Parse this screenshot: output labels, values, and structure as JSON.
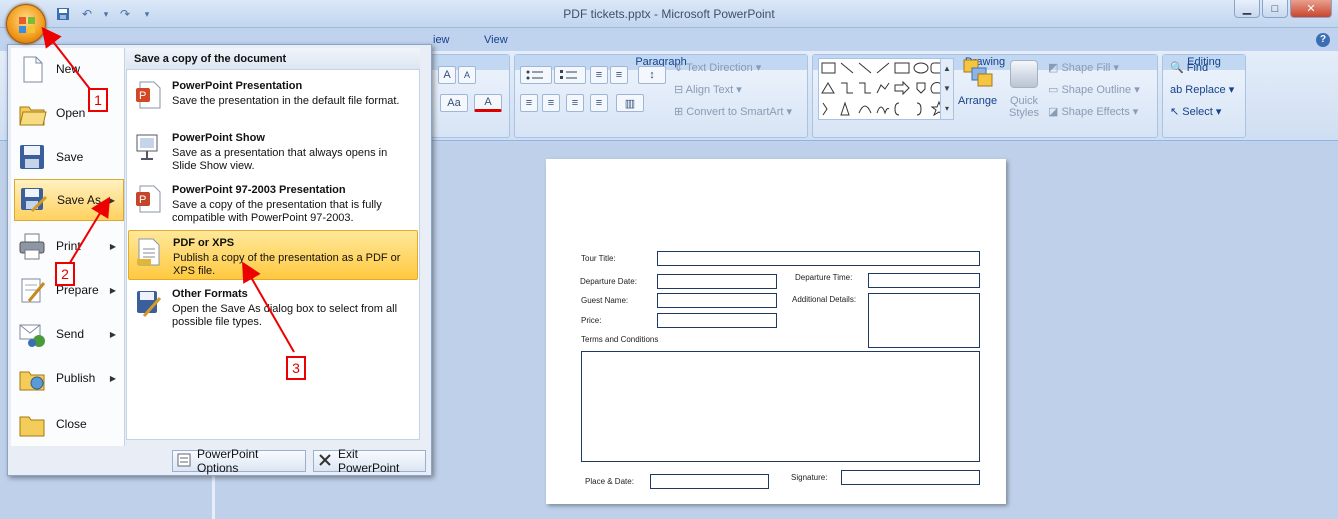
{
  "window": {
    "title": "PDF tickets.pptx - Microsoft PowerPoint",
    "min": "▁",
    "max": "□",
    "close": "✕"
  },
  "qat": {
    "save": "💾",
    "undo": "↶",
    "undo_arrow": "▾",
    "redo": "↷",
    "customize": "▾"
  },
  "tabs": [
    "iew",
    "View"
  ],
  "help": "?",
  "ribbon": {
    "font_group": {
      "grow": "A",
      "shrink": "A",
      "case": "Aa",
      "color": "A"
    },
    "paragraph": {
      "label": "Paragraph",
      "text_direction": "Text Direction",
      "align_text": "Align Text",
      "smartart": "Convert to SmartArt"
    },
    "drawing": {
      "label": "Drawing",
      "arrange": "Arrange",
      "quick_styles": "Quick Styles",
      "shape_fill": "Shape Fill",
      "shape_outline": "Shape Outline",
      "shape_effects": "Shape Effects"
    },
    "editing": {
      "label": "Editing",
      "find": "Find",
      "replace": "Replace",
      "select": "Select"
    }
  },
  "menu": {
    "left_items": [
      {
        "label": "New",
        "icon": "new-document-icon"
      },
      {
        "label": "Open",
        "icon": "open-folder-icon"
      },
      {
        "label": "Save",
        "icon": "save-disk-icon"
      },
      {
        "label": "Save As",
        "icon": "save-as-icon",
        "arrow": "▶"
      },
      {
        "label": "Print",
        "icon": "printer-icon",
        "arrow": "▶"
      },
      {
        "label": "Prepare",
        "icon": "prepare-icon",
        "arrow": "▶"
      },
      {
        "label": "Send",
        "icon": "send-icon",
        "arrow": "▶"
      },
      {
        "label": "Publish",
        "icon": "publish-icon",
        "arrow": "▶"
      },
      {
        "label": "Close",
        "icon": "close-folder-icon"
      }
    ],
    "right_header": "Save a copy of the document",
    "options": [
      {
        "title": "PowerPoint Presentation",
        "desc": "Save the presentation in the default file format."
      },
      {
        "title": "PowerPoint Show",
        "desc": "Save as a presentation that always opens in Slide Show view."
      },
      {
        "title": "PowerPoint 97-2003 Presentation",
        "desc": "Save a copy of the presentation that is fully compatible with PowerPoint 97-2003."
      },
      {
        "title": "PDF or XPS",
        "desc": "Publish a copy of the presentation as a PDF or XPS file."
      },
      {
        "title": "Other Formats",
        "desc": "Open the Save As dialog box to select from all possible file types."
      }
    ],
    "options_button": "PowerPoint Options",
    "exit_button": "Exit PowerPoint"
  },
  "slide": {
    "tour_title": "Tour Title:",
    "departure_date": "Departure Date:",
    "departure_time": "Departure Time:",
    "guest_name": "Guest Name:",
    "additional_details": "Additional Details:",
    "price": "Price:",
    "terms": "Terms and Conditions",
    "place_date": "Place & Date:",
    "signature": "Signature:"
  },
  "callouts": [
    "1",
    "2",
    "3"
  ],
  "colors": {
    "accent": "#15428b",
    "highlight": "#ffc940",
    "callout": "#e00000"
  }
}
